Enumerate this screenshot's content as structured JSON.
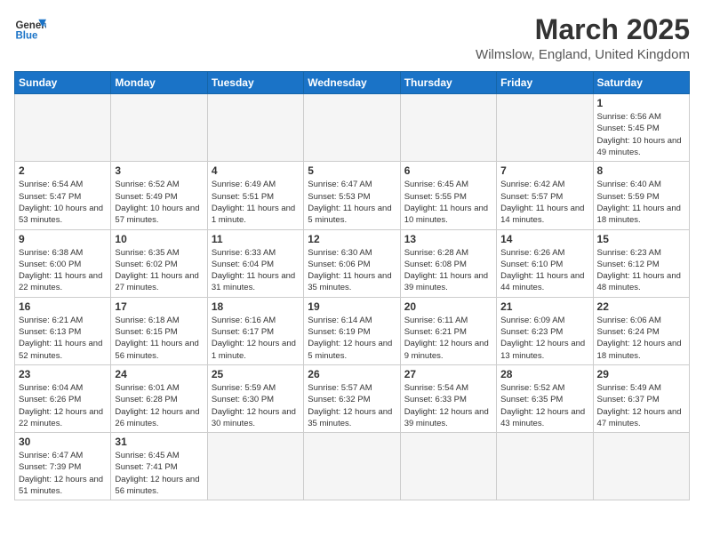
{
  "header": {
    "logo_line1": "General",
    "logo_line2": "Blue",
    "month_title": "March 2025",
    "location": "Wilmslow, England, United Kingdom"
  },
  "weekdays": [
    "Sunday",
    "Monday",
    "Tuesday",
    "Wednesday",
    "Thursday",
    "Friday",
    "Saturday"
  ],
  "weeks": [
    [
      {
        "day": "",
        "info": ""
      },
      {
        "day": "",
        "info": ""
      },
      {
        "day": "",
        "info": ""
      },
      {
        "day": "",
        "info": ""
      },
      {
        "day": "",
        "info": ""
      },
      {
        "day": "",
        "info": ""
      },
      {
        "day": "1",
        "info": "Sunrise: 6:56 AM\nSunset: 5:45 PM\nDaylight: 10 hours and 49 minutes."
      }
    ],
    [
      {
        "day": "2",
        "info": "Sunrise: 6:54 AM\nSunset: 5:47 PM\nDaylight: 10 hours and 53 minutes."
      },
      {
        "day": "3",
        "info": "Sunrise: 6:52 AM\nSunset: 5:49 PM\nDaylight: 10 hours and 57 minutes."
      },
      {
        "day": "4",
        "info": "Sunrise: 6:49 AM\nSunset: 5:51 PM\nDaylight: 11 hours and 1 minute."
      },
      {
        "day": "5",
        "info": "Sunrise: 6:47 AM\nSunset: 5:53 PM\nDaylight: 11 hours and 5 minutes."
      },
      {
        "day": "6",
        "info": "Sunrise: 6:45 AM\nSunset: 5:55 PM\nDaylight: 11 hours and 10 minutes."
      },
      {
        "day": "7",
        "info": "Sunrise: 6:42 AM\nSunset: 5:57 PM\nDaylight: 11 hours and 14 minutes."
      },
      {
        "day": "8",
        "info": "Sunrise: 6:40 AM\nSunset: 5:59 PM\nDaylight: 11 hours and 18 minutes."
      }
    ],
    [
      {
        "day": "9",
        "info": "Sunrise: 6:38 AM\nSunset: 6:00 PM\nDaylight: 11 hours and 22 minutes."
      },
      {
        "day": "10",
        "info": "Sunrise: 6:35 AM\nSunset: 6:02 PM\nDaylight: 11 hours and 27 minutes."
      },
      {
        "day": "11",
        "info": "Sunrise: 6:33 AM\nSunset: 6:04 PM\nDaylight: 11 hours and 31 minutes."
      },
      {
        "day": "12",
        "info": "Sunrise: 6:30 AM\nSunset: 6:06 PM\nDaylight: 11 hours and 35 minutes."
      },
      {
        "day": "13",
        "info": "Sunrise: 6:28 AM\nSunset: 6:08 PM\nDaylight: 11 hours and 39 minutes."
      },
      {
        "day": "14",
        "info": "Sunrise: 6:26 AM\nSunset: 6:10 PM\nDaylight: 11 hours and 44 minutes."
      },
      {
        "day": "15",
        "info": "Sunrise: 6:23 AM\nSunset: 6:12 PM\nDaylight: 11 hours and 48 minutes."
      }
    ],
    [
      {
        "day": "16",
        "info": "Sunrise: 6:21 AM\nSunset: 6:13 PM\nDaylight: 11 hours and 52 minutes."
      },
      {
        "day": "17",
        "info": "Sunrise: 6:18 AM\nSunset: 6:15 PM\nDaylight: 11 hours and 56 minutes."
      },
      {
        "day": "18",
        "info": "Sunrise: 6:16 AM\nSunset: 6:17 PM\nDaylight: 12 hours and 1 minute."
      },
      {
        "day": "19",
        "info": "Sunrise: 6:14 AM\nSunset: 6:19 PM\nDaylight: 12 hours and 5 minutes."
      },
      {
        "day": "20",
        "info": "Sunrise: 6:11 AM\nSunset: 6:21 PM\nDaylight: 12 hours and 9 minutes."
      },
      {
        "day": "21",
        "info": "Sunrise: 6:09 AM\nSunset: 6:23 PM\nDaylight: 12 hours and 13 minutes."
      },
      {
        "day": "22",
        "info": "Sunrise: 6:06 AM\nSunset: 6:24 PM\nDaylight: 12 hours and 18 minutes."
      }
    ],
    [
      {
        "day": "23",
        "info": "Sunrise: 6:04 AM\nSunset: 6:26 PM\nDaylight: 12 hours and 22 minutes."
      },
      {
        "day": "24",
        "info": "Sunrise: 6:01 AM\nSunset: 6:28 PM\nDaylight: 12 hours and 26 minutes."
      },
      {
        "day": "25",
        "info": "Sunrise: 5:59 AM\nSunset: 6:30 PM\nDaylight: 12 hours and 30 minutes."
      },
      {
        "day": "26",
        "info": "Sunrise: 5:57 AM\nSunset: 6:32 PM\nDaylight: 12 hours and 35 minutes."
      },
      {
        "day": "27",
        "info": "Sunrise: 5:54 AM\nSunset: 6:33 PM\nDaylight: 12 hours and 39 minutes."
      },
      {
        "day": "28",
        "info": "Sunrise: 5:52 AM\nSunset: 6:35 PM\nDaylight: 12 hours and 43 minutes."
      },
      {
        "day": "29",
        "info": "Sunrise: 5:49 AM\nSunset: 6:37 PM\nDaylight: 12 hours and 47 minutes."
      }
    ],
    [
      {
        "day": "30",
        "info": "Sunrise: 6:47 AM\nSunset: 7:39 PM\nDaylight: 12 hours and 51 minutes."
      },
      {
        "day": "31",
        "info": "Sunrise: 6:45 AM\nSunset: 7:41 PM\nDaylight: 12 hours and 56 minutes."
      },
      {
        "day": "",
        "info": ""
      },
      {
        "day": "",
        "info": ""
      },
      {
        "day": "",
        "info": ""
      },
      {
        "day": "",
        "info": ""
      },
      {
        "day": "",
        "info": ""
      }
    ]
  ]
}
